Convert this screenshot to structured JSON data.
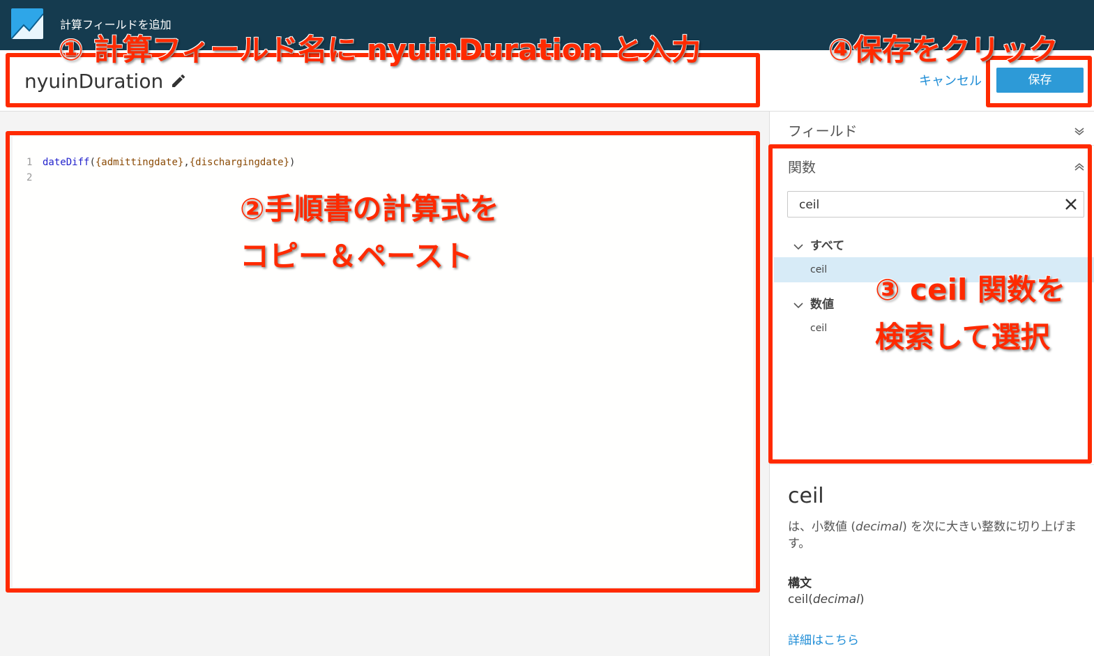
{
  "app": {
    "title": "計算フィールドを追加"
  },
  "header": {
    "field_name": "nyuinDuration",
    "cancel_label": "キャンセル",
    "save_label": "保存"
  },
  "editor": {
    "line_numbers": [
      "1",
      "2"
    ],
    "code_fn": "dateDiff",
    "code_open": "(",
    "code_arg1": "{admittingdate}",
    "code_sep": ",",
    "code_arg2": "{dischargingdate}",
    "code_close": ")"
  },
  "panel": {
    "fields_title": "フィールド",
    "functions_title": "関数",
    "search_value": "ceil",
    "categories": [
      {
        "label": "すべて",
        "items": [
          "ceil"
        ]
      },
      {
        "label": "数値",
        "items": [
          "ceil"
        ]
      }
    ],
    "detail": {
      "title": "ceil",
      "description_1": "は、小数値 (",
      "description_em": "decimal",
      "description_2": ") を次に大きい整数に切り上げます。",
      "syntax_label": "構文",
      "syntax_fn": "ceil(",
      "syntax_arg": "decimal",
      "syntax_close": ")",
      "more_link": "詳細はこちら"
    }
  },
  "annotations": {
    "step1": "① 計算フィールド名に nyuinDuration と入力",
    "step2_line1": "②手順書の計算式を",
    "step2_line2": "コピー＆ペースト",
    "step3_line1": "③ ceil 関数を",
    "step3_line2": "検索して選択",
    "step4": "④保存をクリック",
    "color": "#ff2a00"
  },
  "icons": {
    "logo": "quicksight-logo-icon",
    "edit": "pencil-icon",
    "clear": "close-icon",
    "collapse": "chevron-up-icon",
    "expand": "chevron-down-icon"
  }
}
